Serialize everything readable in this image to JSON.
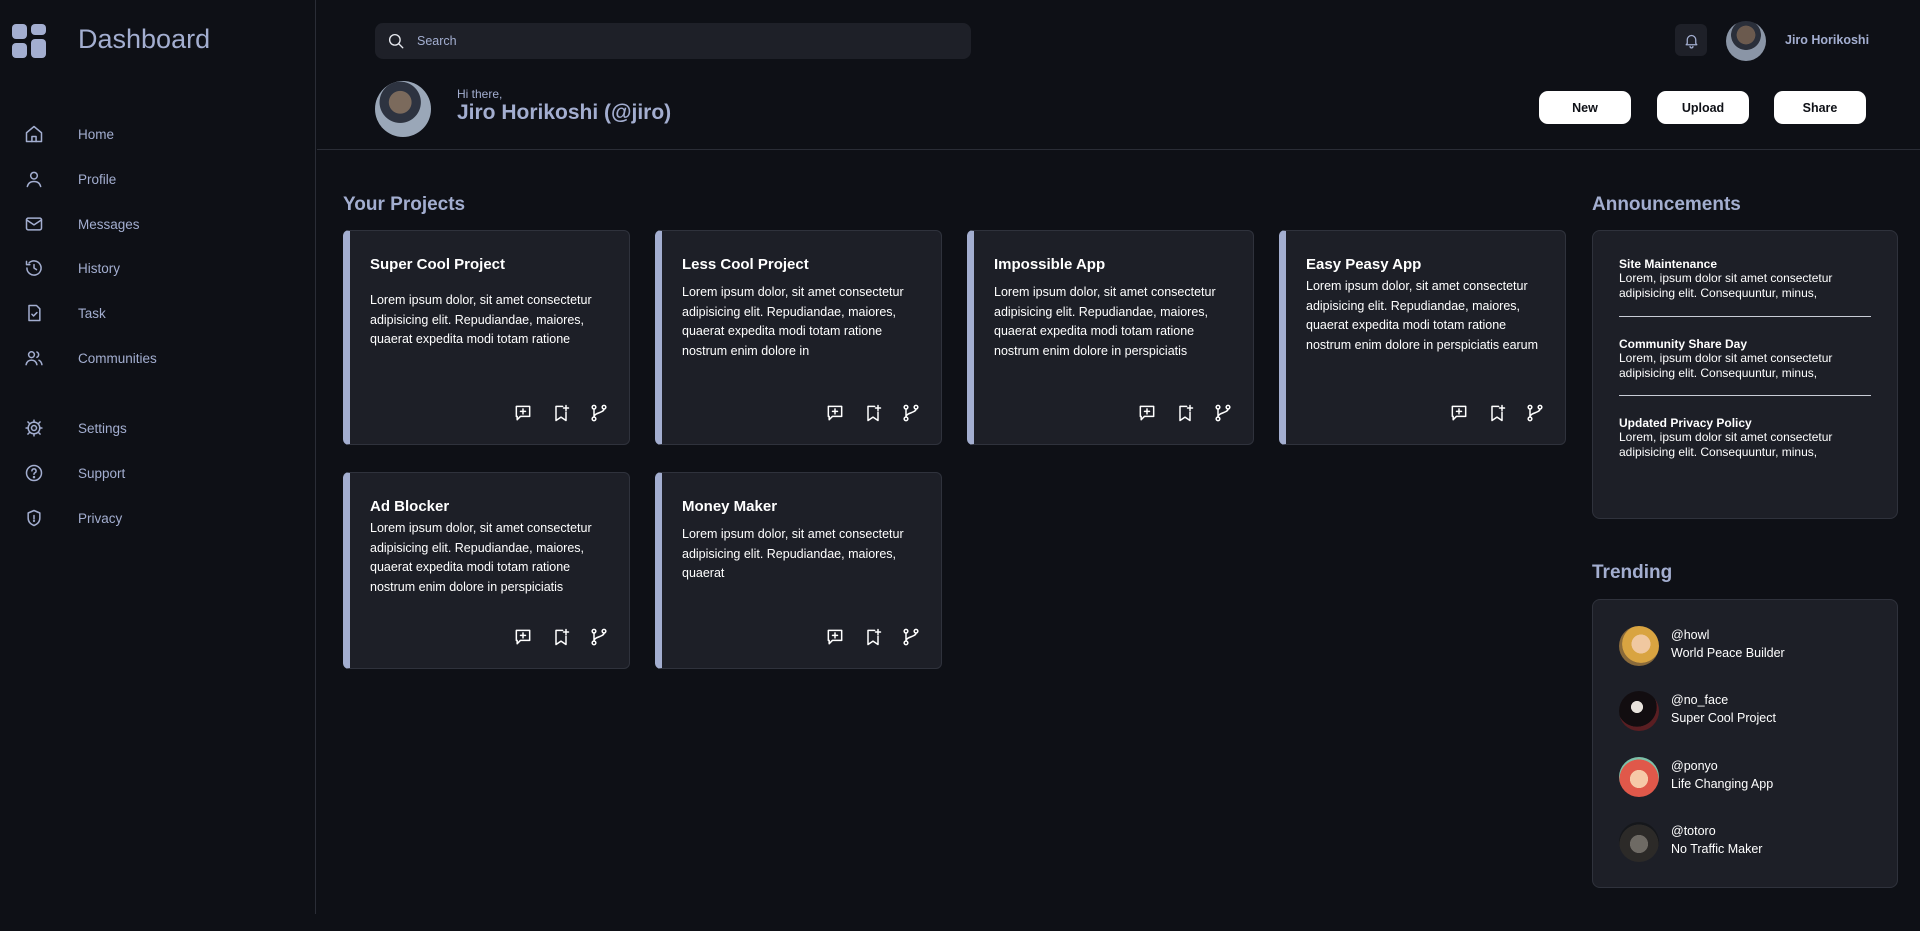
{
  "sidebar": {
    "brand": "Dashboard",
    "items": [
      {
        "label": "Home",
        "icon": "home-icon"
      },
      {
        "label": "Profile",
        "icon": "user-icon"
      },
      {
        "label": "Messages",
        "icon": "mail-icon"
      },
      {
        "label": "History",
        "icon": "history-icon"
      },
      {
        "label": "Task",
        "icon": "task-icon"
      },
      {
        "label": "Communities",
        "icon": "users-icon"
      },
      {
        "label": "Settings",
        "icon": "gear-icon"
      },
      {
        "label": "Support",
        "icon": "help-icon"
      },
      {
        "label": "Privacy",
        "icon": "shield-icon"
      }
    ]
  },
  "header": {
    "search_placeholder": "Search",
    "user_name": "Jiro Horikoshi",
    "greeting": "Hi there,",
    "full_name": "Jiro Horikoshi (@jiro)",
    "buttons": {
      "new": "New",
      "upload": "Upload",
      "share": "Share"
    }
  },
  "projects": {
    "title": "Your Projects",
    "items": [
      {
        "title": "Super Cool Project",
        "desc": "Lorem ipsum dolor, sit amet consectetur adipisicing elit. Repudiandae, maiores, quaerat expedita modi totam ratione"
      },
      {
        "title": "Less Cool Project",
        "desc": "Lorem ipsum dolor, sit amet consectetur adipisicing elit. Repudiandae, maiores, quaerat expedita modi totam ratione nostrum enim dolore in"
      },
      {
        "title": "Impossible App",
        "desc": "Lorem ipsum dolor, sit amet consectetur adipisicing elit. Repudiandae, maiores, quaerat expedita modi totam ratione nostrum enim dolore in perspiciatis"
      },
      {
        "title": "Easy Peasy App",
        "desc": "Lorem ipsum dolor, sit amet consectetur adipisicing elit. Repudiandae, maiores, quaerat expedita modi totam ratione nostrum enim dolore in perspiciatis earum"
      },
      {
        "title": "Ad Blocker",
        "desc": "Lorem ipsum dolor, sit amet consectetur adipisicing elit. Repudiandae, maiores, quaerat expedita modi totam ratione nostrum enim dolore in perspiciatis"
      },
      {
        "title": "Money Maker",
        "desc": "Lorem ipsum dolor, sit amet consectetur adipisicing elit. Repudiandae, maiores, quaerat"
      }
    ]
  },
  "announcements": {
    "title": "Announcements",
    "items": [
      {
        "title": "Site Maintenance",
        "body": "Lorem, ipsum dolor sit amet consectetur adipisicing elit. Consequuntur, minus,"
      },
      {
        "title": "Community Share Day",
        "body": "Lorem, ipsum dolor sit amet consectetur adipisicing elit. Consequuntur, minus,"
      },
      {
        "title": "Updated Privacy Policy",
        "body": "Lorem, ipsum dolor sit amet consectetur adipisicing elit. Consequuntur, minus,"
      }
    ]
  },
  "trending": {
    "title": "Trending",
    "items": [
      {
        "handle": "@howl",
        "project": "World Peace Builder"
      },
      {
        "handle": "@no_face",
        "project": "Super Cool Project"
      },
      {
        "handle": "@ponyo",
        "project": "Life Changing App"
      },
      {
        "handle": "@totoro",
        "project": "No Traffic Maker"
      }
    ]
  },
  "colors": {
    "background": "#0e1016",
    "accent": "#a3aed0",
    "card": "#1d1f27"
  }
}
